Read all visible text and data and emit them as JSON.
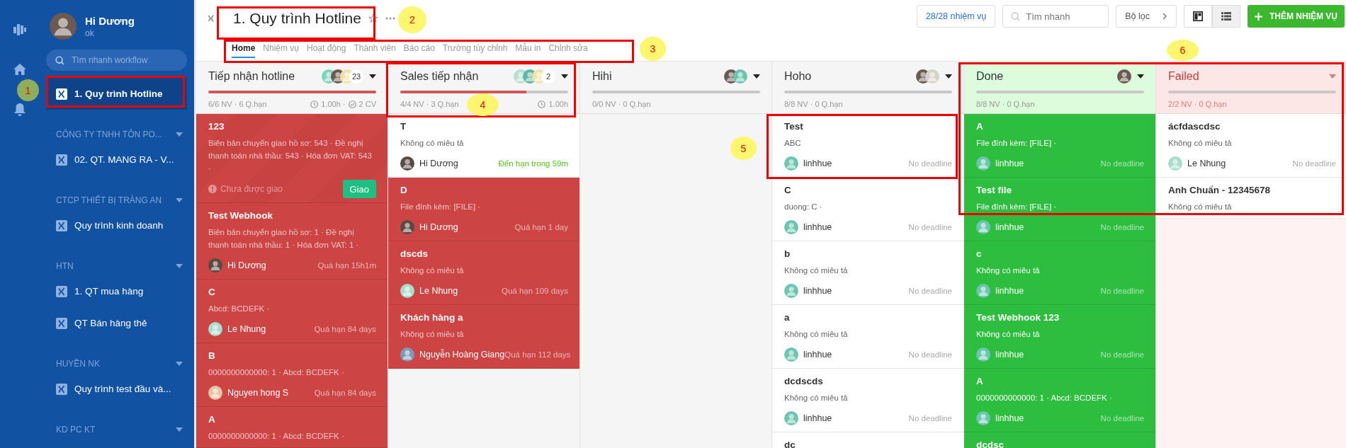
{
  "rail": {
    "items": [
      {
        "kind": "logo"
      },
      {
        "kind": "home"
      },
      {
        "kind": "bell"
      }
    ]
  },
  "sidebar": {
    "user": {
      "name": "Hi Dương",
      "status": "ok"
    },
    "search": {
      "placeholder": "Tìm nhanh workflow"
    },
    "items": [
      {
        "label": "1. Quy trình Hotline",
        "selected": true
      }
    ],
    "groups": [
      {
        "heading": "CÔNG TY TNHH TÔN PO...",
        "items": [
          {
            "label": "02. QT. MANG RA - V...",
            "selected": false
          }
        ]
      },
      {
        "heading": "CTCP THIẾT BỊ TRÀNG AN",
        "items": [
          {
            "label": "Quy trình kinh doanh",
            "selected": false
          }
        ]
      },
      {
        "heading": "HTN",
        "items": [
          {
            "label": "1. QT mua hàng",
            "selected": false
          },
          {
            "label": "QT Bán hàng thẻ",
            "selected": false
          }
        ]
      },
      {
        "heading": "HUYỀN NK",
        "items": [
          {
            "label": "Quy trình test đầu và...",
            "selected": false
          }
        ]
      },
      {
        "heading": "KD PC KT"
      }
    ]
  },
  "header": {
    "title": "1. Quy trình Hotline",
    "tabs": [
      {
        "label": "Home",
        "selected": true
      },
      {
        "label": "Nhiệm vụ",
        "selected": false
      },
      {
        "label": "Hoạt động",
        "selected": false
      },
      {
        "label": "Thành viên",
        "selected": false
      },
      {
        "label": "Báo cáo",
        "selected": false
      },
      {
        "label": "Trường tùy chỉnh",
        "selected": false
      },
      {
        "label": "Mẫu in",
        "selected": false
      },
      {
        "label": "Chỉnh sửa",
        "selected": false
      }
    ],
    "task_count": "28/28 nhiệm vụ",
    "search": {
      "placeholder": "Tìm nhanh"
    },
    "filter": "Bộ lọc",
    "views": [
      {
        "kind": "board",
        "selected": true
      },
      {
        "kind": "list",
        "selected": false
      }
    ],
    "add_button": "THÊM NHIỆM VỤ"
  },
  "columns": [
    {
      "title": "Tiếp nhận hotline",
      "kind": "default",
      "avatars": [
        {
          "color": "#7fd3bf"
        },
        {
          "color": "#6b5a50"
        },
        {
          "color": "#f3e2a8"
        }
      ],
      "count": "23",
      "level": 1,
      "meta": "6/6 NV · 6 Q.hạn",
      "stats": [
        {
          "kind": "clock",
          "text": "1.00h ·"
        },
        {
          "kind": "check",
          "text": "2 CV"
        }
      ],
      "cards": [
        {
          "title": "123",
          "desc": "Biên bản chuyển giao hồ sơ: 543 · Đề nghị thanh toán nhà thầu: 543 · Hóa đơn VAT: 543 ·",
          "kind": "overdue",
          "striped": true,
          "note": "Chưa được giao",
          "action": "Giao"
        },
        {
          "title": "Test Webhook",
          "desc": "Biên bản chuyển giao hồ sơ: 1 · Đề nghị thanh toán nhà thầu: 1 · Hóa đơn VAT: 1 ·",
          "kind": "overdue",
          "assignee": {
            "name": "Hi Dương",
            "color": "#5a4a44"
          },
          "due": "Quá hạn 15h1m",
          "due_soon": false
        },
        {
          "title": "C",
          "desc": "Abcd: BCDEFK ·",
          "kind": "overdue",
          "assignee": {
            "name": "Le Nhung",
            "color": "#a8dccb"
          },
          "due": "Quá hạn 84 days",
          "due_soon": false
        },
        {
          "title": "B",
          "desc": "0000000000000: 1 · Abcd: BCDEFK ·",
          "kind": "overdue",
          "assignee": {
            "name": "Nguyen hong S",
            "color": "#e6c3a5"
          },
          "due": "Quá hạn 84 days",
          "due_soon": false
        },
        {
          "title": "A",
          "desc": "0000000000000: 1 · Abcd: BCDEFK ·",
          "kind": "overdue"
        }
      ]
    },
    {
      "title": "Sales tiếp nhận",
      "kind": "default",
      "avatars": [
        {
          "color": "#b8e0d0"
        },
        {
          "color": "#5fb8a5"
        },
        {
          "color": "#f3e2a8"
        }
      ],
      "count": "2",
      "level": 0.75,
      "meta": "4/4 NV · 3 Q.hạn",
      "stats": [
        {
          "kind": "clock",
          "text": "1.00h"
        }
      ],
      "cards": [
        {
          "title": "T",
          "desc": "Không có miêu tả",
          "kind": "normal",
          "assignee": {
            "name": "Hi Dương",
            "color": "#5a4a44"
          },
          "due": "Đến hạn trong 59m",
          "due_soon": true
        },
        {
          "title": "D",
          "desc": "File đính kèm: [FILE] ·",
          "kind": "overdue",
          "assignee": {
            "name": "Hi Dương",
            "color": "#5a4a44"
          },
          "due": "Quá hạn 1 day",
          "due_soon": false
        },
        {
          "title": "dscds",
          "desc": "Không có miêu tả",
          "kind": "overdue",
          "assignee": {
            "name": "Le Nhung",
            "color": "#a8dccb"
          },
          "due": "Quá hạn 109 days",
          "due_soon": false
        },
        {
          "title": "Khách hàng a",
          "desc": "Không có miêu tả",
          "kind": "overdue",
          "assignee": {
            "name": "Nguyễn Hoàng Giang",
            "color": "#7a9ab8"
          },
          "due": "Quá hạn 112 days",
          "due_soon": false
        }
      ]
    },
    {
      "title": "Hihi",
      "kind": "default",
      "avatars": [
        {
          "color": "#6b5a50"
        },
        {
          "color": "#6cc5b0"
        }
      ],
      "level": 0,
      "meta": "0/0 NV · 0 Q.hạn"
    },
    {
      "title": "Hoho",
      "kind": "default",
      "avatars": [
        {
          "color": "#6b5a50"
        },
        {
          "color": "#d8d2cc"
        }
      ],
      "level": 0,
      "meta": "8/8 NV · 0 Q.hạn",
      "cards": [
        {
          "title": "Test",
          "desc": "ABC",
          "kind": "normal",
          "assignee": {
            "name": "linhhue",
            "color": "#6cc5b0"
          },
          "due": "No deadline",
          "due_soon": false
        },
        {
          "title": "C",
          "desc": "duong: C ·",
          "kind": "normal",
          "assignee": {
            "name": "linhhue",
            "color": "#6cc5b0"
          },
          "due": "No deadline",
          "due_soon": false
        },
        {
          "title": "b",
          "desc": "Không có miêu tả",
          "kind": "normal",
          "assignee": {
            "name": "linhhue",
            "color": "#6cc5b0"
          },
          "due": "No deadline",
          "due_soon": false
        },
        {
          "title": "a",
          "desc": "Không có miêu tả",
          "kind": "normal",
          "assignee": {
            "name": "linhhue",
            "color": "#6cc5b0"
          },
          "due": "No deadline",
          "due_soon": false
        },
        {
          "title": "dcdscds",
          "desc": "Không có miêu tả",
          "kind": "normal",
          "assignee": {
            "name": "linhhue",
            "color": "#6cc5b0"
          },
          "due": "No deadline",
          "due_soon": false
        },
        {
          "title": "dc",
          "kind": "normal"
        }
      ]
    },
    {
      "title": "Done",
      "kind": "done",
      "avatars": [
        {
          "color": "#6b5a50"
        }
      ],
      "level": 0,
      "meta": "8/8 NV · 0 Q.hạn",
      "cards": [
        {
          "title": "A",
          "desc": "File đính kèm: [FILE] ·",
          "kind": "done",
          "assignee": {
            "name": "linhhue",
            "color": "#6cc5b0"
          },
          "due": "No deadline",
          "due_soon": false
        },
        {
          "title": "Test file",
          "desc": "File đính kèm: [FILE] ·",
          "kind": "done",
          "assignee": {
            "name": "linhhue",
            "color": "#6cc5b0"
          },
          "due": "No deadline",
          "due_soon": false
        },
        {
          "title": "c",
          "desc": "Không có miêu tả",
          "kind": "done",
          "assignee": {
            "name": "linhhue",
            "color": "#6cc5b0"
          },
          "due": "No deadline",
          "due_soon": false
        },
        {
          "title": "Test Webhook 123",
          "desc": "Không có miêu tả",
          "kind": "done",
          "assignee": {
            "name": "linhhue",
            "color": "#6cc5b0"
          },
          "due": "No deadline",
          "due_soon": false
        },
        {
          "title": "A",
          "desc": "0000000000000: 1 · Abcd: BCDEFK ·",
          "kind": "done",
          "assignee": {
            "name": "linhhue",
            "color": "#6cc5b0"
          },
          "due": "No deadline",
          "due_soon": false
        },
        {
          "title": "dcdsc",
          "kind": "done"
        }
      ]
    },
    {
      "title": "Failed",
      "kind": "failed",
      "level": 0,
      "meta": "2/2 NV · 0 Q.hạn",
      "cards": [
        {
          "title": "ácfdascdsc",
          "desc": "Không có miêu tả",
          "kind": "normal",
          "assignee": {
            "name": "Le Nhung",
            "color": "#a8dccb"
          },
          "due": "No deadline",
          "due_soon": false
        },
        {
          "title": "Anh Chuẩn - 12345678",
          "desc": "Không có miêu tả",
          "kind": "normal"
        }
      ]
    }
  ],
  "annotations": [
    {
      "label": "1",
      "color": "#8fae5a"
    },
    {
      "label": "2",
      "color": "#fdf66e"
    },
    {
      "label": "3",
      "color": "#fdf66e"
    },
    {
      "label": "4",
      "color": "#fdf66e"
    },
    {
      "label": "5",
      "color": "#fdf66e"
    },
    {
      "label": "6",
      "color": "#fdf66e"
    }
  ]
}
